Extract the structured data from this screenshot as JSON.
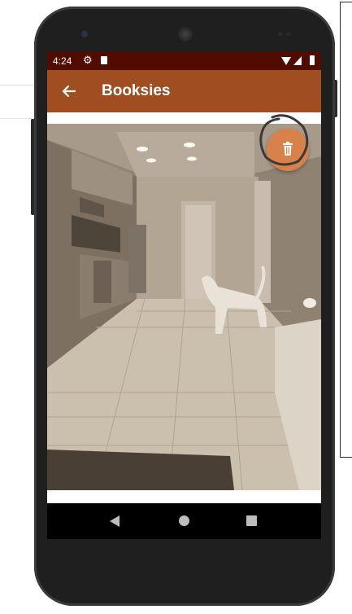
{
  "status_bar": {
    "time": "4:24"
  },
  "app_bar": {
    "title": "Booksies"
  },
  "fab": {
    "icon": "trash-icon",
    "color": "#d8814a"
  },
  "colors": {
    "status_bar": "#520b00",
    "app_bar": "#a04d21",
    "fab": "#d8814a"
  },
  "photo": {
    "subject": "interior-photo"
  },
  "nav_bar": {
    "items": [
      "back",
      "home",
      "recents"
    ]
  }
}
